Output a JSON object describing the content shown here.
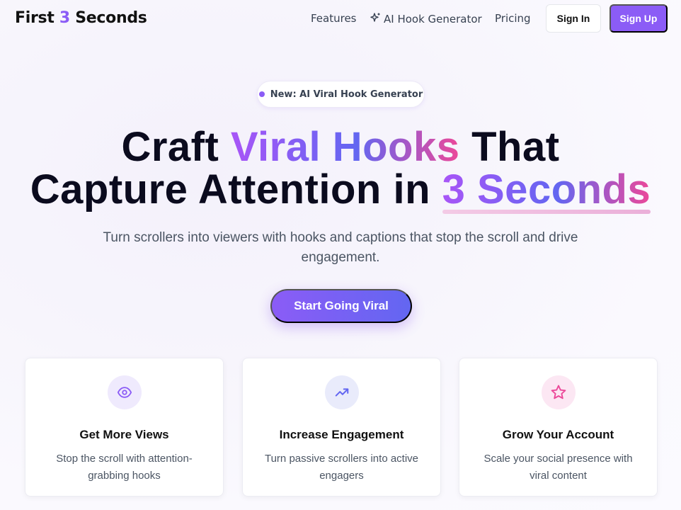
{
  "nav": {
    "logo_part1": "First",
    "logo_accent": "3",
    "logo_part2": "Seconds",
    "links": {
      "features": "Features",
      "hook_generator": "AI Hook Generator",
      "pricing": "Pricing"
    },
    "sign_in": "Sign In",
    "sign_up": "Sign Up"
  },
  "hero": {
    "badge": "New: AI Viral Hook Generator",
    "headline_1": "Craft",
    "headline_2": "Viral Hooks",
    "headline_3": "That",
    "headline_4": "Capture Attention in",
    "headline_5": "3 Seconds",
    "subtitle": "Turn scrollers into viewers with hooks and captions that stop the scroll and drive engagement.",
    "cta": "Start Going Viral"
  },
  "features": [
    {
      "icon": "eye-icon",
      "title": "Get More Views",
      "description": "Stop the scroll with attention-grabbing hooks"
    },
    {
      "icon": "trending-up-icon",
      "title": "Increase Engagement",
      "description": "Turn passive scrollers into active engagers"
    },
    {
      "icon": "star-icon",
      "title": "Grow Your Account",
      "description": "Scale your social presence with viral content"
    }
  ],
  "colors": {
    "accent": "#8b5cf6",
    "indigo": "#6366f1",
    "pink": "#ec4899"
  }
}
